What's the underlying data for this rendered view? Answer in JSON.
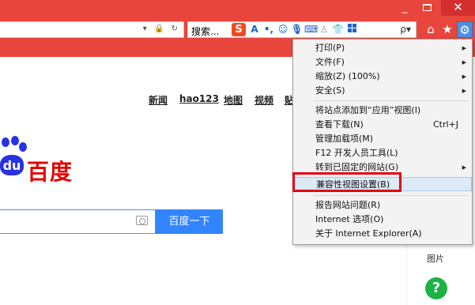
{
  "window": {
    "minimize": "_",
    "close": "✕"
  },
  "toolbar": {
    "address_icons": "▾ 🔒 ↻",
    "search_placeholder": "搜索...",
    "ime_logo": "S",
    "ime_a": "A",
    "search_icon": "ρ▾",
    "home": "⌂",
    "star": "★",
    "gear": "⚙"
  },
  "page": {
    "nav_links": [
      "新闻",
      "hao123",
      "地图",
      "视频",
      "贴"
    ],
    "logo_text": "百度",
    "logo_pad": "du",
    "search_button": "百度一下",
    "side_label": "图片",
    "help": "?"
  },
  "menu": {
    "items": [
      {
        "label": "打印(P)",
        "arrow": "▶"
      },
      {
        "label": "文件(F)",
        "arrow": "▶"
      },
      {
        "label": "缩放(Z) (100%)",
        "arrow": "▶"
      },
      {
        "label": "安全(S)",
        "arrow": "▶"
      },
      {
        "label": "将站点添加到“应用”视图(I)"
      },
      {
        "label": "查看下载(N)",
        "shortcut": "Ctrl+J"
      },
      {
        "label": "管理加载项(M)"
      },
      {
        "label": "F12 开发人员工具(L)"
      },
      {
        "label": "转到已固定的网站(G)",
        "arrow": "▶"
      },
      {
        "label": "兼容性视图设置(B)"
      },
      {
        "label": "报告网站问题(R)"
      },
      {
        "label": "Internet 选项(O)"
      },
      {
        "label": "关于 Internet Explorer(A)"
      }
    ],
    "highlighted": "兼容性视图设置(B)"
  }
}
